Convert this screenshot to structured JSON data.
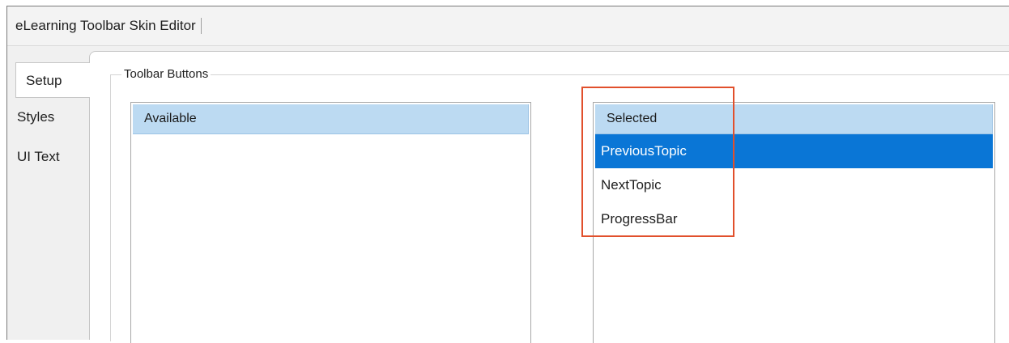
{
  "window": {
    "title": "eLearning Toolbar Skin Editor"
  },
  "tabs": [
    {
      "label": "Setup",
      "active": true
    },
    {
      "label": "Styles",
      "active": false
    },
    {
      "label": "UI Text",
      "active": false
    }
  ],
  "group": {
    "label": "Toolbar Buttons"
  },
  "available": {
    "header": "Available",
    "items": []
  },
  "selected": {
    "header": "Selected",
    "items": [
      {
        "label": "PreviousTopic",
        "selected": true
      },
      {
        "label": "NextTopic",
        "selected": false
      },
      {
        "label": "ProgressBar",
        "selected": false
      }
    ]
  },
  "colors": {
    "header_bg": "#bcdaf2",
    "selection": "#0a76d6",
    "callout": "#e1502c"
  }
}
